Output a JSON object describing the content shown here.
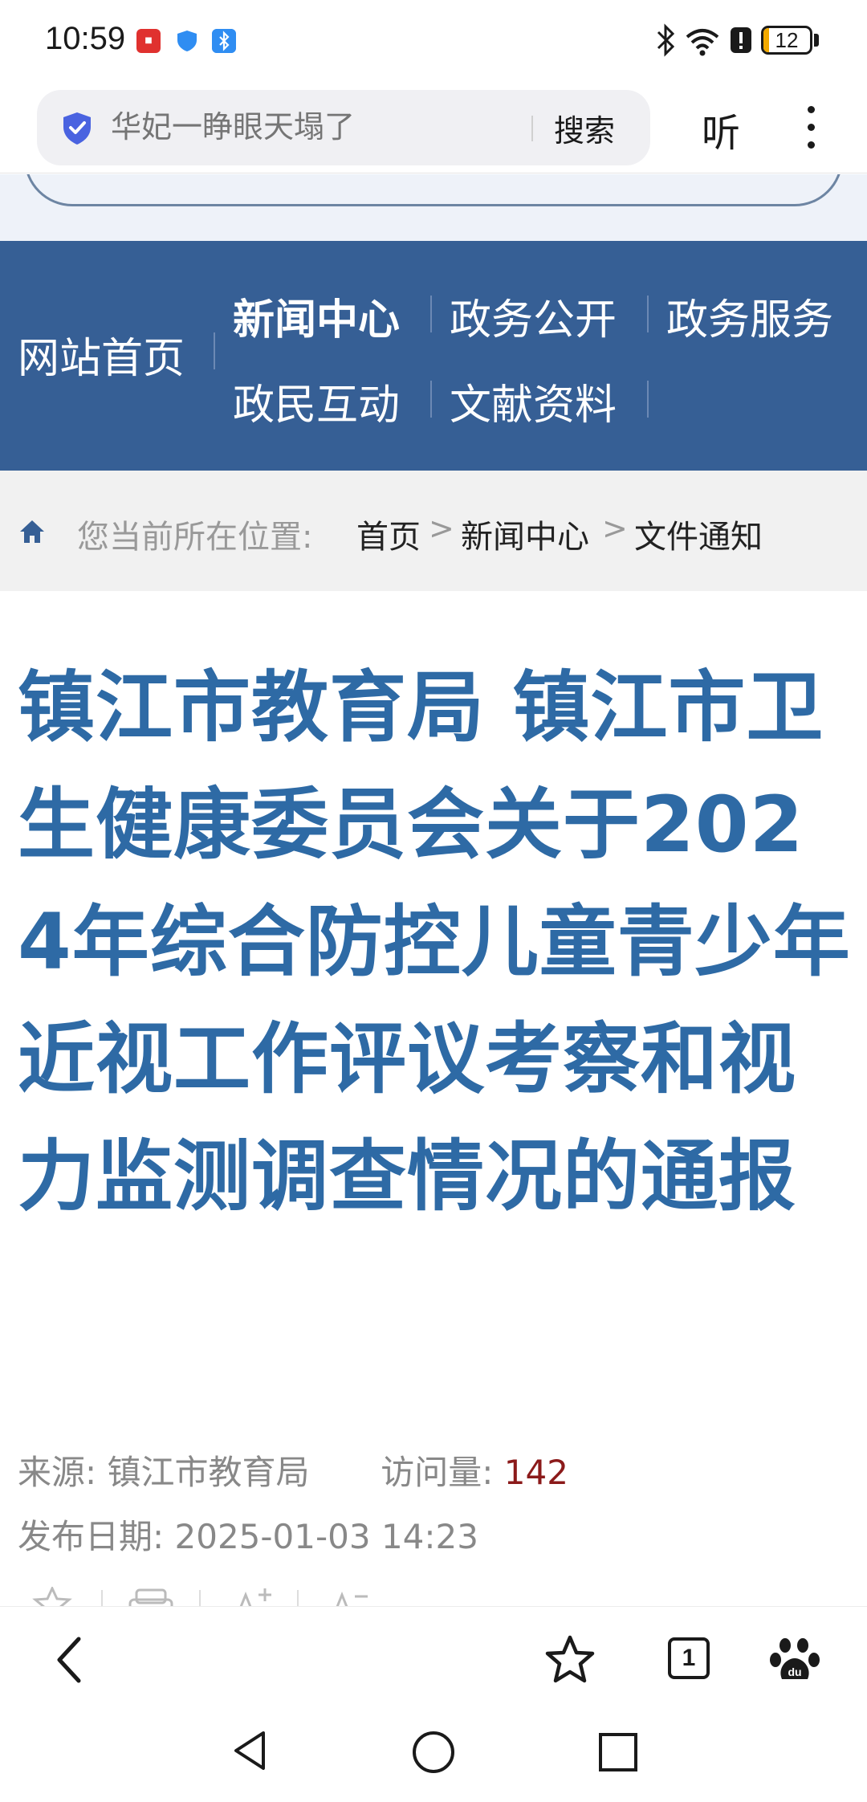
{
  "status_bar": {
    "time": "10:59",
    "battery_level": "12",
    "battery_fraction": 0.12,
    "icons": [
      "red-app-icon",
      "shield-icon",
      "bluetooth-app-icon",
      "bluetooth-icon",
      "wifi-icon",
      "alert-icon",
      "battery-icon"
    ]
  },
  "browser": {
    "search_placeholder": "华妃一睁眼天塌了",
    "search_button": "搜索",
    "listen_button": "听",
    "more_icon": "more-vertical-icon"
  },
  "nav": {
    "home": "网站首页",
    "items": [
      {
        "label": "新闻中心",
        "active": true
      },
      {
        "label": "政务公开",
        "active": false
      },
      {
        "label": "政务服务",
        "active": false
      },
      {
        "label": "政民互动",
        "active": false
      },
      {
        "label": "文献资料",
        "active": false
      }
    ]
  },
  "breadcrumb": {
    "label": "您当前所在位置:",
    "path": [
      "首页",
      "新闻中心",
      "文件通知"
    ],
    "separator": ">"
  },
  "article": {
    "title": "镇江市教育局 镇江市卫生健康委员会关于2024年综合防控儿童青少年近视工作评议考察和视力监测调查情况的通报",
    "source_label": "来源:",
    "source_value": "镇江市教育局",
    "views_label": "访问量:",
    "views_value": "142",
    "date_label": "发布日期:",
    "date_value": "2025-01-03 14:23"
  },
  "bottom_bar": {
    "tab_count": "1",
    "icons": [
      "back-arrow-icon",
      "star-icon",
      "tabs-icon",
      "baidu-paw-icon"
    ]
  },
  "colors": {
    "nav_bg": "#365f95",
    "title": "#2e6aa5",
    "views_count": "#8b1a1a",
    "breadcrumb_bg": "#f1f1f1"
  }
}
